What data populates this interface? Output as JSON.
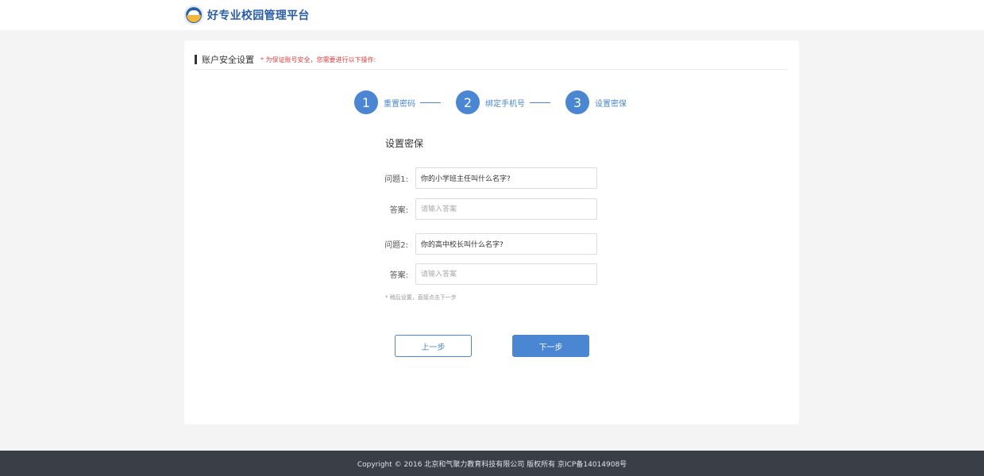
{
  "header": {
    "logo_icon": "school-logo-icon",
    "app_title": "好专业校园管理平台"
  },
  "card": {
    "title": "账户安全设置",
    "note": "* 为保证账号安全，您需要进行以下操作:"
  },
  "steps": [
    {
      "number": "1",
      "label": "重置密码"
    },
    {
      "number": "2",
      "label": "绑定手机号"
    },
    {
      "number": "3",
      "label": "设置密保"
    }
  ],
  "form": {
    "title": "设置密保",
    "q1": {
      "label": "问题1:",
      "value": "你的小学班主任叫什么名字?"
    },
    "a1": {
      "label": "答案:",
      "placeholder": "请输入答案",
      "value": ""
    },
    "q2": {
      "label": "问题2:",
      "value": "你的高中校长叫什么名字?"
    },
    "a2": {
      "label": "答案:",
      "placeholder": "请输入答案",
      "value": ""
    },
    "hint": "* 稍后设置，直接点击下一步"
  },
  "buttons": {
    "prev": "上一步",
    "next": "下一步"
  },
  "footer": {
    "text": "Copyright © 2016 北京和气聚力教育科技有限公司 版权所有 京ICP备14014908号"
  },
  "colors": {
    "accent": "#4a86d1",
    "warning": "#e23b3b",
    "footer_bg": "#3a3f47"
  }
}
